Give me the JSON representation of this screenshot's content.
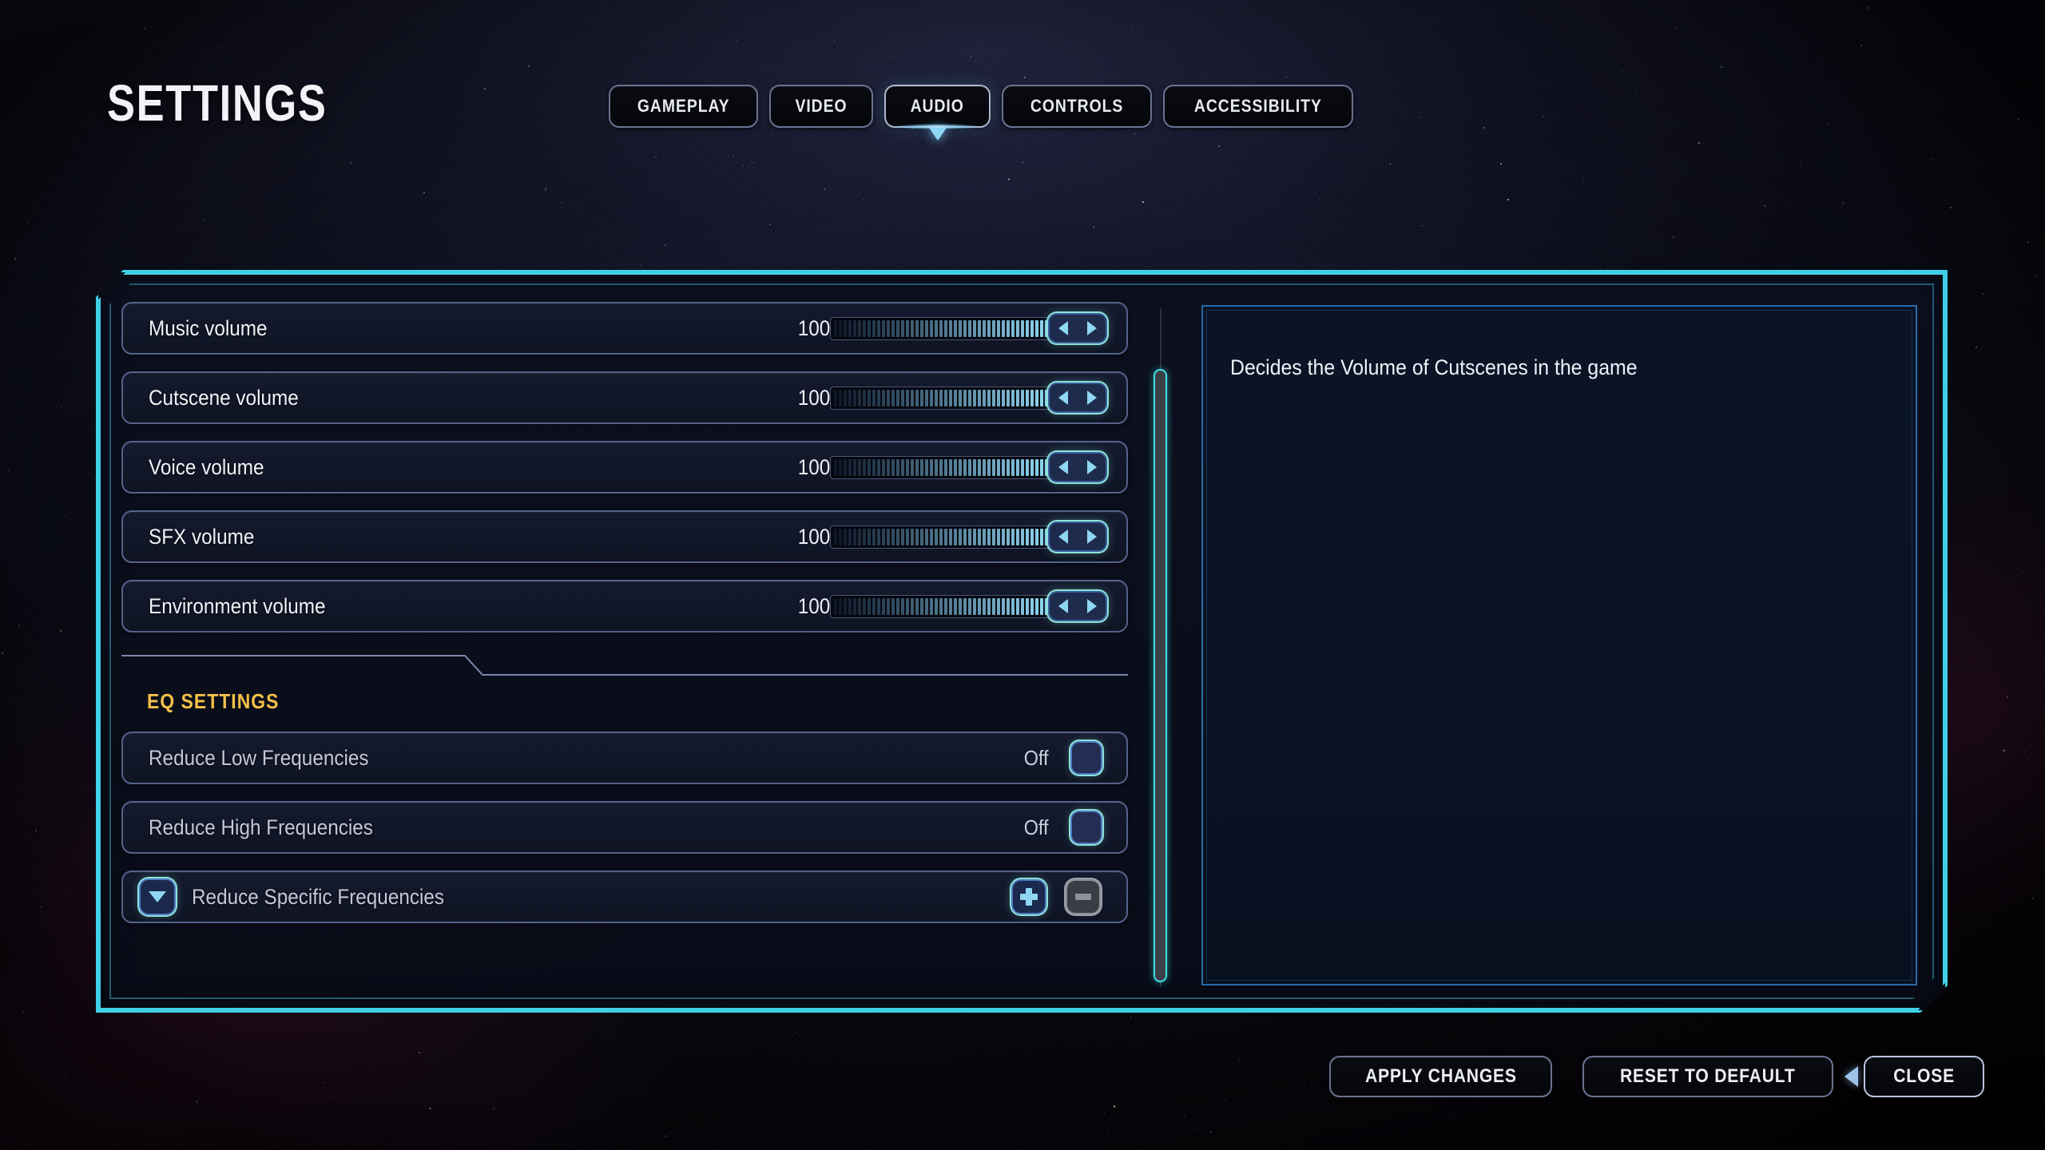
{
  "header": {
    "title": "SETTINGS",
    "tabs": [
      {
        "label": "GAMEPLAY",
        "active": false
      },
      {
        "label": "VIDEO",
        "active": false
      },
      {
        "label": "AUDIO",
        "active": true
      },
      {
        "label": "CONTROLS",
        "active": false
      },
      {
        "label": "ACCESSIBILITY",
        "active": false
      }
    ]
  },
  "settings": {
    "volume_rows": [
      {
        "label": "Music volume",
        "value": "100",
        "fill_percent": 100
      },
      {
        "label": "Cutscene volume",
        "value": "100",
        "fill_percent": 100
      },
      {
        "label": "Voice volume",
        "value": "100",
        "fill_percent": 100
      },
      {
        "label": "SFX volume",
        "value": "100",
        "fill_percent": 100
      },
      {
        "label": "Environment volume",
        "value": "100",
        "fill_percent": 100
      }
    ],
    "eq_section_title": "EQ SETTINGS",
    "eq_rows": [
      {
        "label": "Reduce Low Frequencies",
        "value": "Off",
        "control": "toggle"
      },
      {
        "label": "Reduce High Frequencies",
        "value": "Off",
        "control": "toggle"
      }
    ],
    "expandable_row": {
      "label": "Reduce Specific Frequencies",
      "chevron_icon": "chevron-down-icon",
      "add_icon": "plus-icon",
      "remove_icon": "minus-icon",
      "remove_disabled": true
    }
  },
  "description": {
    "text": "Decides the Volume of Cutscenes in the game"
  },
  "footer": {
    "buttons": [
      {
        "label": "APPLY CHANGES",
        "focused": false
      },
      {
        "label": "RESET TO DEFAULT",
        "focused": false
      },
      {
        "label": "CLOSE",
        "focused": true
      }
    ]
  },
  "colors": {
    "accent_cyan": "#3fd0e6",
    "accent_gold": "#f5c04a",
    "slider_fill": "#8ed6f2",
    "panel_bg": "#0b1020",
    "row_border": "#55618a",
    "desc_border": "#2a6aa8"
  }
}
